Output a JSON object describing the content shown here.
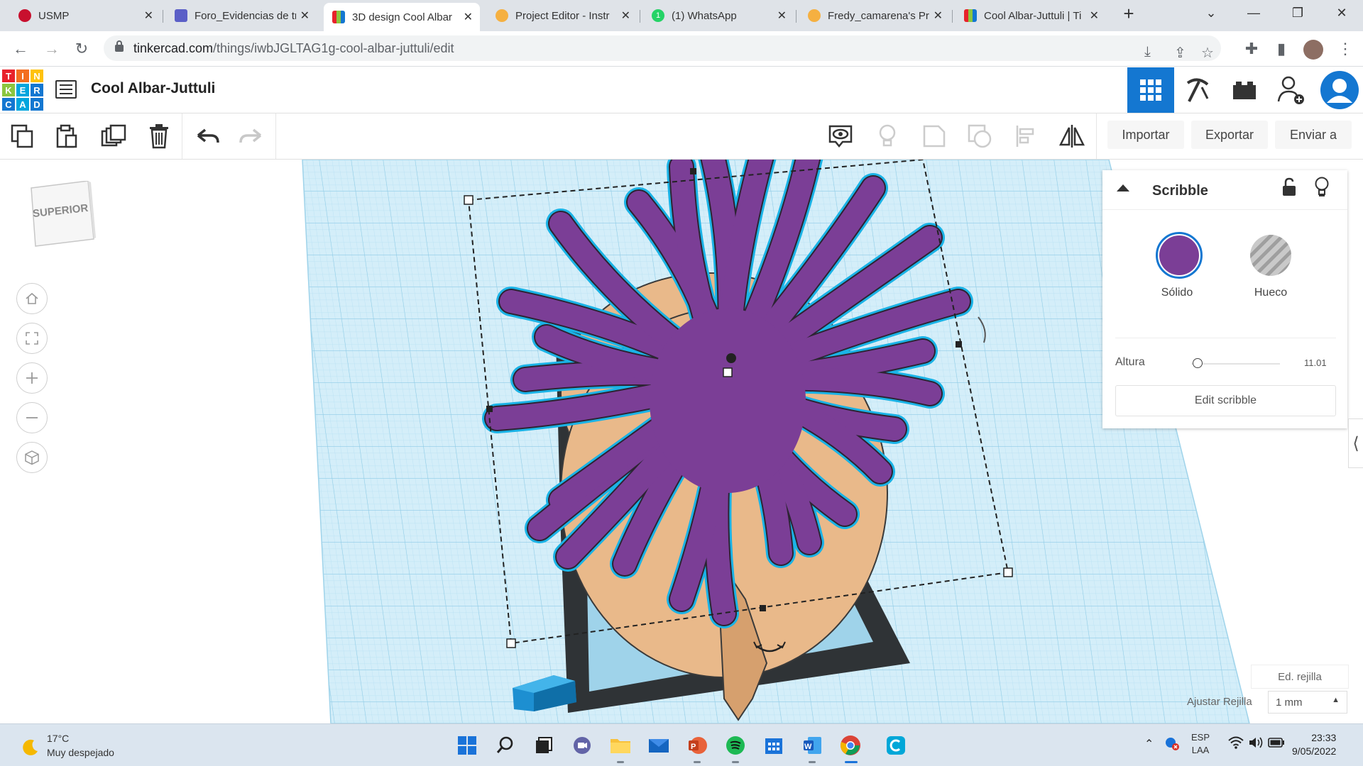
{
  "browser": {
    "tabs": [
      {
        "title": "USMP",
        "favicon_color": "#c8102e"
      },
      {
        "title": "Foro_Evidencias de tr",
        "favicon_color": "#5b5fc7"
      },
      {
        "title": "3D design Cool Albar",
        "favicon_color": "#e74c3c"
      },
      {
        "title": "Project Editor - Instr",
        "favicon_color": "#f5b041"
      },
      {
        "title": "(1) WhatsApp",
        "favicon_color": "#25d366",
        "badge": "1"
      },
      {
        "title": "Fredy_camarena's Pr",
        "favicon_color": "#f5b041"
      },
      {
        "title": "Cool Albar-Juttuli | Ti",
        "favicon_color": "#e74c3c"
      }
    ],
    "active_tab": 2,
    "new_tab_label": "+",
    "url_host": "tinkercad.com",
    "url_path": "/things/iwbJGLTAG1g-cool-albar-juttuli/edit"
  },
  "app": {
    "logo_letters": [
      "T",
      "I",
      "N",
      "K",
      "E",
      "R",
      "C",
      "A",
      "D"
    ],
    "logo_colors": [
      "#e8222b",
      "#f36f21",
      "#ffc20e",
      "#8cc63f",
      "#00a6de",
      "#1477d1",
      "#1477d1",
      "#00a6de",
      "#1477d1"
    ],
    "title": "Cool Albar-Juttuli",
    "accent": "#1477d1"
  },
  "toolbar": {
    "import_label": "Importar",
    "export_label": "Exportar",
    "send_label": "Enviar a"
  },
  "viewport": {
    "viewcube_label": "SUPERIOR",
    "shape_color": "#7b3e96",
    "shape_outline": "#1ab3e6",
    "under_color": "#e9b98a"
  },
  "inspector": {
    "title": "Scribble",
    "solid_label": "Sólido",
    "hole_label": "Hueco",
    "solid_color": "#7b3e96",
    "param_label": "Altura",
    "param_value": "11.01",
    "edit_button_label": "Edit scribble"
  },
  "grid": {
    "edit_grid_label": "Ed. rejilla",
    "snap_label": "Ajustar Rejilla",
    "snap_value": "1 mm"
  },
  "taskbar": {
    "weather_temp": "17°C",
    "weather_desc": "Muy despejado",
    "lang_1": "ESP",
    "lang_2": "LAA",
    "time": "23:33",
    "date": "9/05/2022"
  }
}
